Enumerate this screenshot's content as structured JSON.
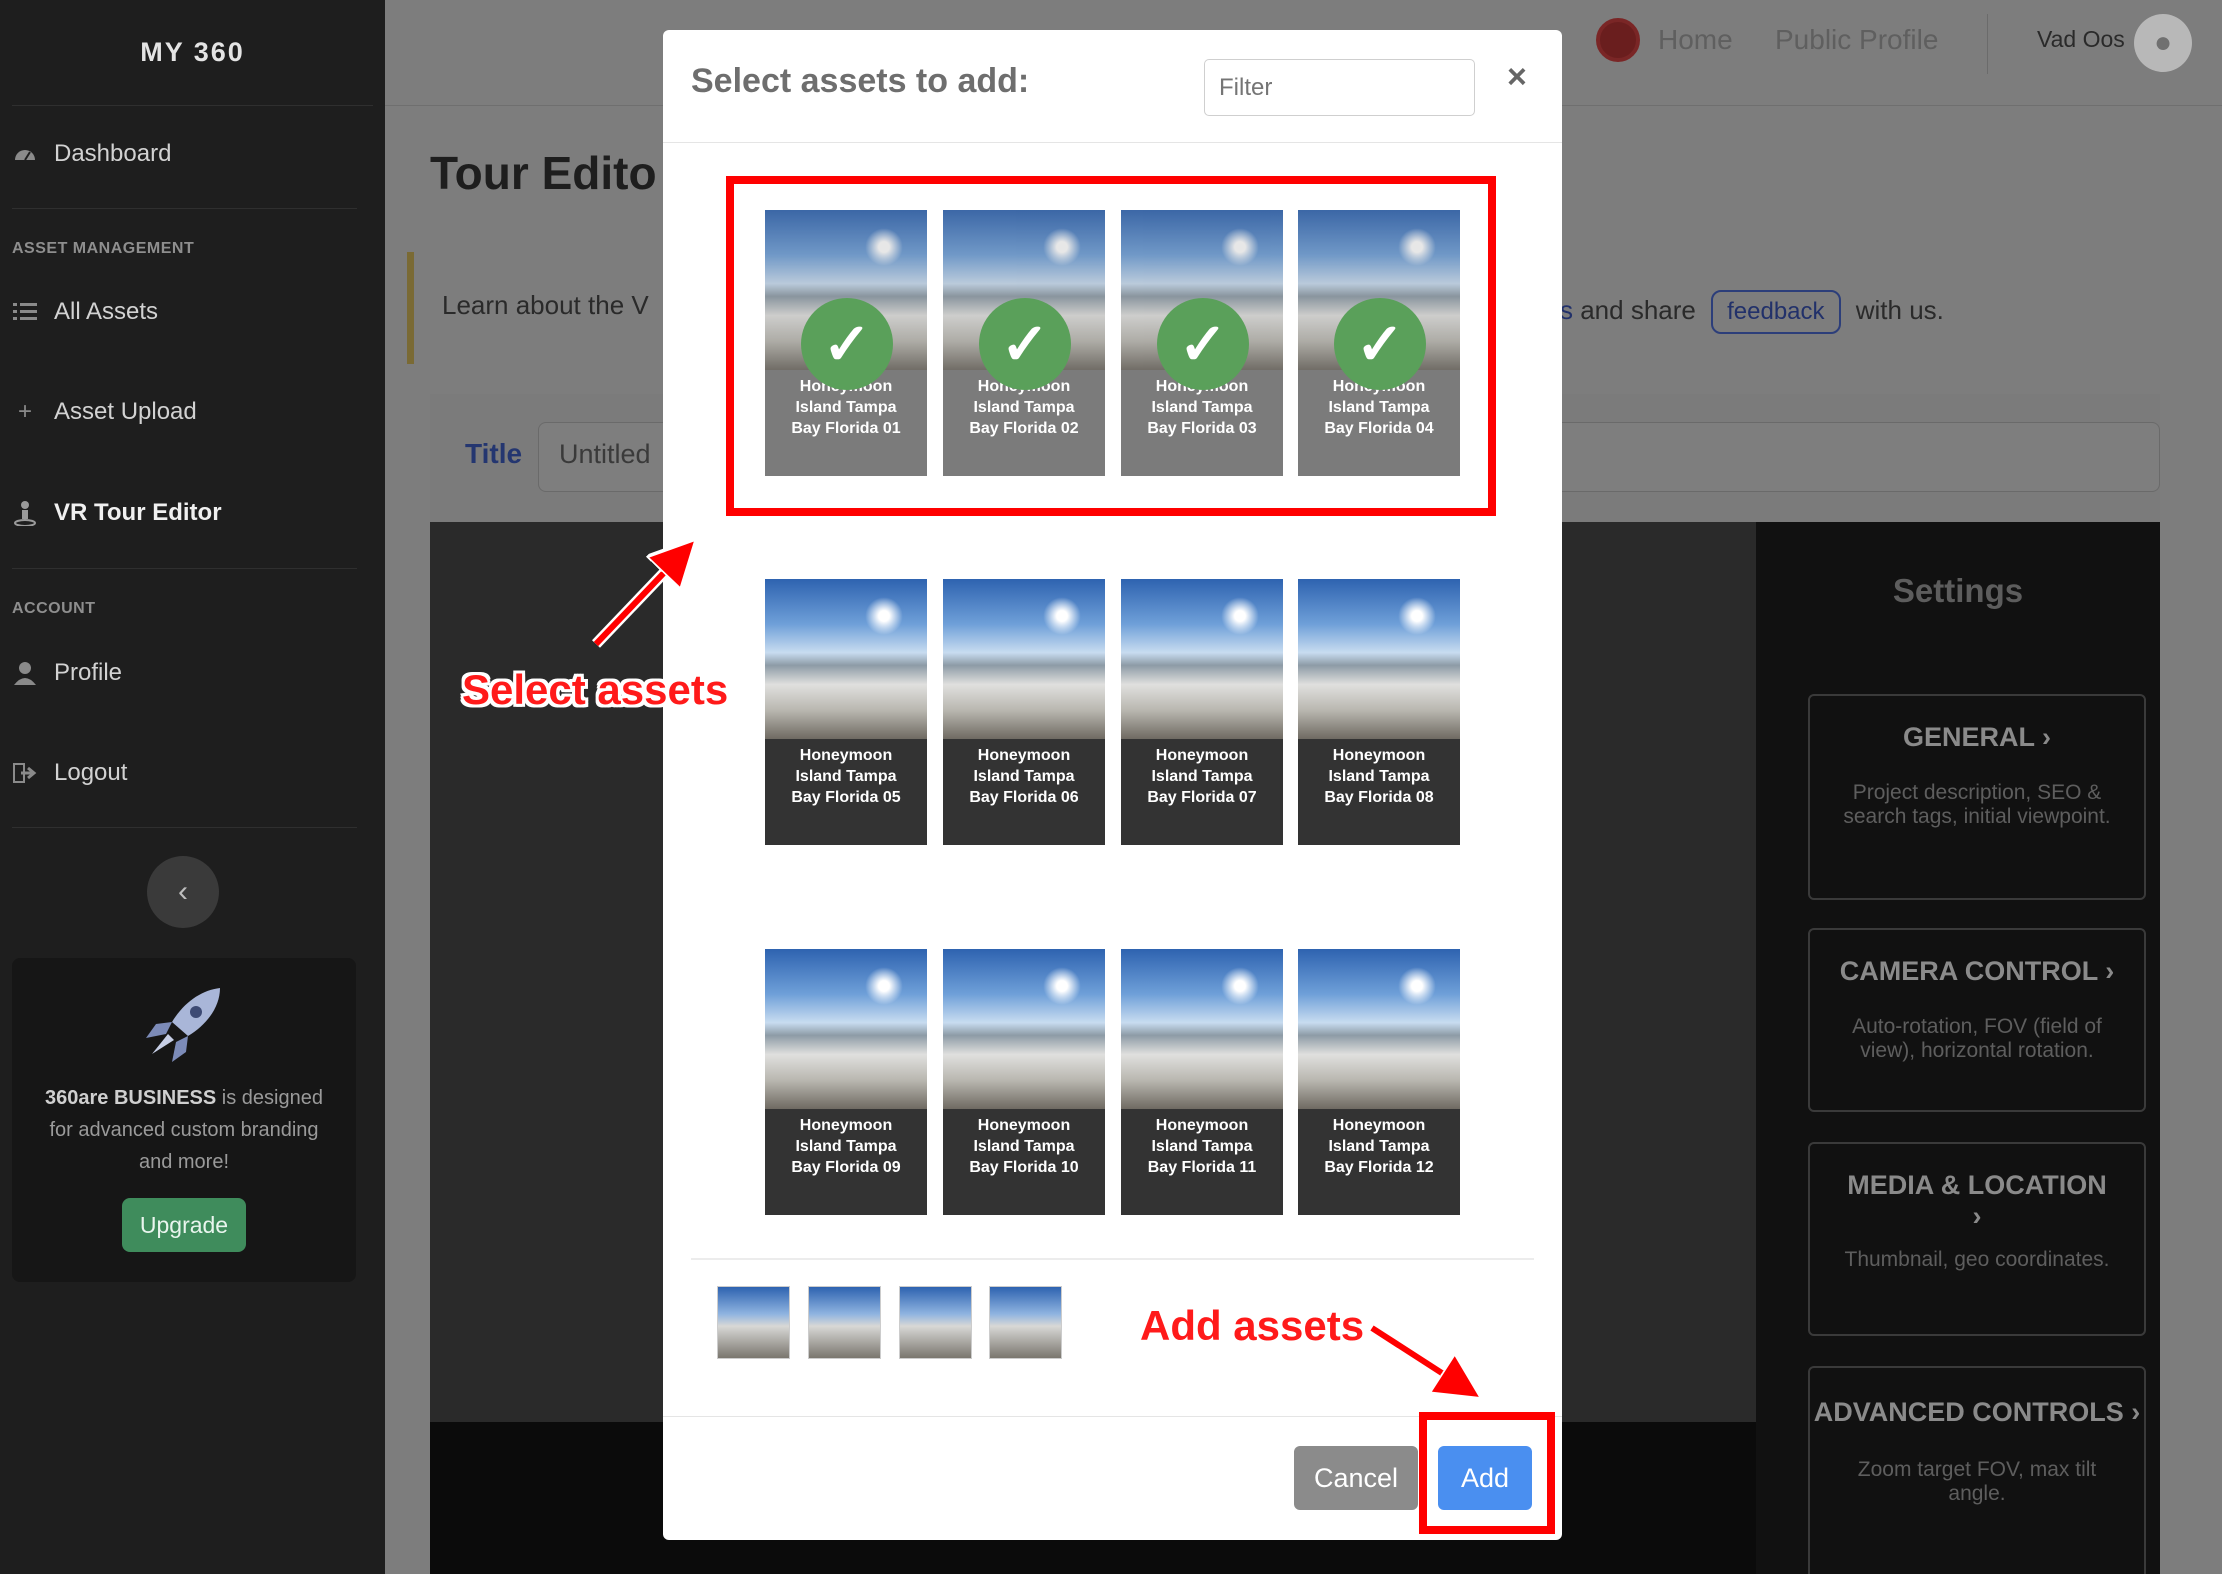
{
  "sidebar": {
    "brand": "MY 360",
    "dashboard": "Dashboard",
    "asset_heading": "ASSET MANAGEMENT",
    "all_assets": "All Assets",
    "asset_upload": "Asset Upload",
    "vr_tour_editor": "VR Tour Editor",
    "account_heading": "ACCOUNT",
    "profile": "Profile",
    "logout": "Logout",
    "promo_brand": "360are BUSINESS",
    "promo_text": " is designed for advanced custom branding and more!",
    "upgrade": "Upgrade"
  },
  "topbar": {
    "home": "Home",
    "public_profile": "Public Profile",
    "user_name": "Vad Oos"
  },
  "page": {
    "title": "Tour Edito",
    "info_left": "Learn about the V",
    "info_s": "s",
    "info_and_share": " and share",
    "feedback": "feedback",
    "info_with_us": "with us.",
    "title_label": "Title",
    "title_value": "Untitled"
  },
  "settings": {
    "heading": "Settings",
    "general": "GENERAL",
    "general_desc": "Project description, SEO & search tags, initial viewpoint.",
    "camera": "CAMERA CONTROL",
    "camera_desc": "Auto-rotation, FOV (field of view), horizontal rotation.",
    "media": "MEDIA & LOCATION",
    "media_desc": "Thumbnail, geo coordinates.",
    "advanced": "ADVANCED CONTROLS",
    "advanced_desc": "Zoom target FOV, max tilt angle."
  },
  "modal": {
    "title": "Select assets to add:",
    "filter_placeholder": "Filter",
    "close": "×",
    "cancel": "Cancel",
    "add": "Add",
    "check_glyph": "✓",
    "assets": [
      {
        "line1": "Honeymoon",
        "line2": "Island Tampa",
        "line3": "Bay Florida 01",
        "selected": true
      },
      {
        "line1": "Honeymoon",
        "line2": "Island Tampa",
        "line3": "Bay Florida 02",
        "selected": true
      },
      {
        "line1": "Honeymoon",
        "line2": "Island Tampa",
        "line3": "Bay Florida 03",
        "selected": true
      },
      {
        "line1": "Honeymoon",
        "line2": "Island Tampa",
        "line3": "Bay Florida 04",
        "selected": true
      },
      {
        "line1": "Honeymoon",
        "line2": "Island Tampa",
        "line3": "Bay Florida 05",
        "selected": false
      },
      {
        "line1": "Honeymoon",
        "line2": "Island Tampa",
        "line3": "Bay Florida 06",
        "selected": false
      },
      {
        "line1": "Honeymoon",
        "line2": "Island Tampa",
        "line3": "Bay Florida 07",
        "selected": false
      },
      {
        "line1": "Honeymoon",
        "line2": "Island Tampa",
        "line3": "Bay Florida 08",
        "selected": false
      },
      {
        "line1": "Honeymoon",
        "line2": "Island Tampa",
        "line3": "Bay Florida 09",
        "selected": false
      },
      {
        "line1": "Honeymoon",
        "line2": "Island Tampa",
        "line3": "Bay Florida 10",
        "selected": false
      },
      {
        "line1": "Honeymoon",
        "line2": "Island Tampa",
        "line3": "Bay Florida 11",
        "selected": false
      },
      {
        "line1": "Honeymoon",
        "line2": "Island Tampa",
        "line3": "Bay Florida 12",
        "selected": false
      }
    ]
  },
  "annotations": {
    "select_assets": "Select assets",
    "add_assets": "Add assets",
    "color": "#ff0000"
  },
  "icons": {
    "dashboard": "dashboard-icon",
    "all_assets": "list-icon",
    "asset_upload": "plus-icon",
    "vr_tour": "person-icon",
    "profile": "user-icon",
    "logout": "logout-icon",
    "collapse": "chevron-left-icon",
    "rocket": "rocket-icon"
  }
}
